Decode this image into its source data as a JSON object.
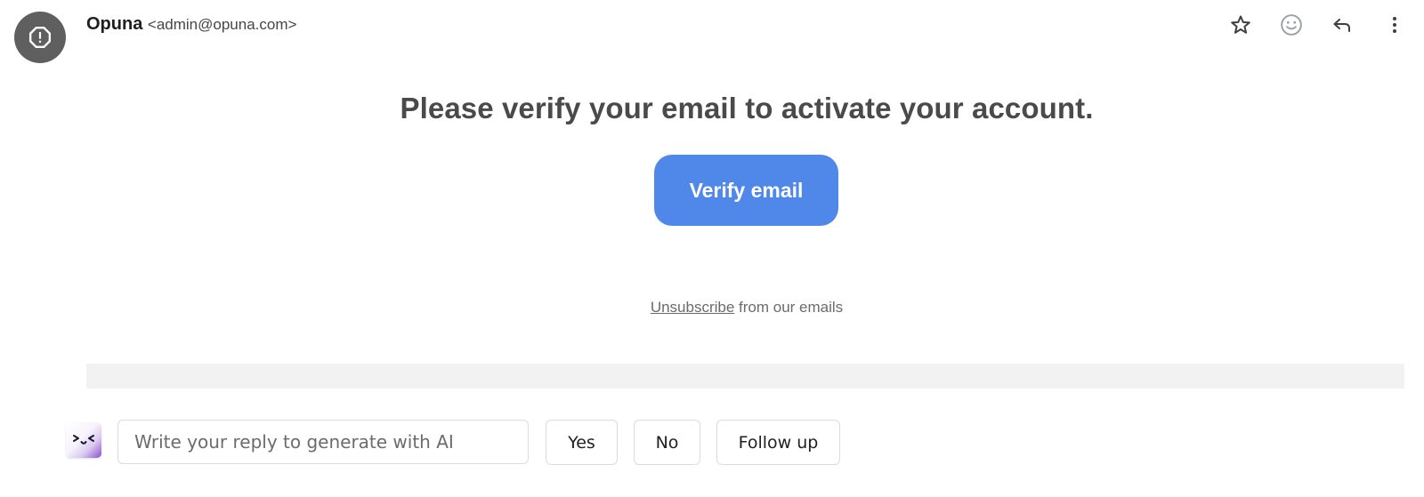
{
  "header": {
    "sender_name": "Opuna",
    "sender_email": "<admin@opuna.com>",
    "avatar_icon": "warning-octagon-icon",
    "actions": [
      {
        "name": "star",
        "icon": "star-icon"
      },
      {
        "name": "emoji-reaction",
        "icon": "smiley-icon"
      },
      {
        "name": "reply",
        "icon": "reply-icon"
      },
      {
        "name": "more-options",
        "icon": "more-vertical-icon"
      }
    ]
  },
  "body": {
    "headline": "Please verify your email to activate your account.",
    "verify_button_label": "Verify email",
    "unsubscribe_link": "Unsubscribe",
    "unsubscribe_suffix": " from our emails"
  },
  "reply_bar": {
    "ai_icon": "ai-assistant-face-icon",
    "input_placeholder": "Write your reply to generate with AI",
    "input_value": "",
    "quick_replies": [
      "Yes",
      "No",
      "Follow up"
    ]
  },
  "colors": {
    "accent_button": "#5088ea",
    "avatar_bg": "#5f5f5f",
    "headline_text": "#4a4a4a"
  }
}
